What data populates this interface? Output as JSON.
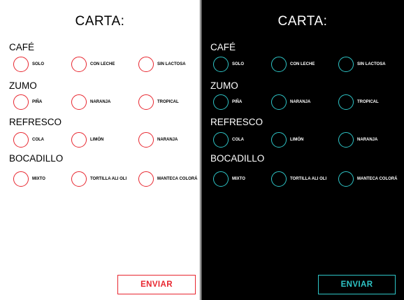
{
  "colors": {
    "light_accent": "#e8262f",
    "dark_accent": "#2ec5c7",
    "light_background": "#ffffff",
    "dark_background": "#000000"
  },
  "menu": {
    "title": "CARTA:",
    "sections": [
      {
        "label": "CAFÉ",
        "options": [
          "SOLO",
          "CON LECHE",
          "SIN LACTOSA"
        ]
      },
      {
        "label": "ZUMO",
        "options": [
          "PIÑA",
          "NARANJA",
          "TROPICAL"
        ]
      },
      {
        "label": "REFRESCO",
        "options": [
          "COLA",
          "LIMÓN",
          "NARANJA"
        ]
      },
      {
        "label": "BOCADILLO",
        "options": [
          "MIXTO",
          "TORTILLA ALI OLI",
          "MANTECA COLORÁ"
        ]
      }
    ],
    "submit_label": "ENVIAR"
  }
}
